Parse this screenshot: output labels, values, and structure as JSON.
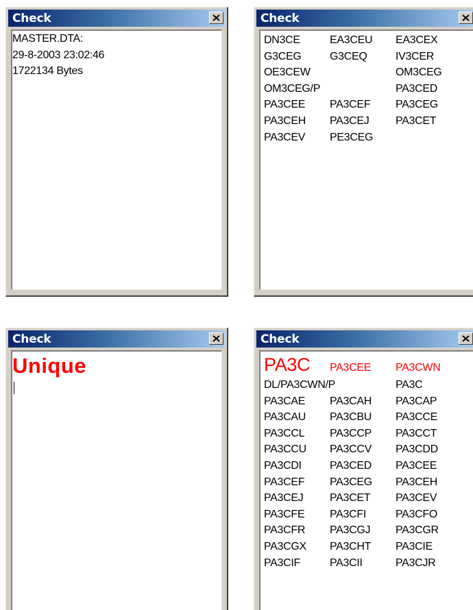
{
  "windows": {
    "w1": {
      "title": "Check",
      "lines": [
        "MASTER.DTA:",
        "29-8-2003 23:02:46",
        "1722134 Bytes"
      ]
    },
    "w2": {
      "title": "Check",
      "calls": [
        "DN3CE",
        "EA3CEU",
        "EA3CEX",
        "G3CEG",
        "G3CEQ",
        "IV3CER",
        "OE3CEW",
        "OM3CEG",
        "OM3CEG/P",
        "PA3CED",
        "PA3CEE",
        "PA3CEF",
        "PA3CEG",
        "PA3CEH",
        "PA3CEJ",
        "PA3CET",
        "PA3CEV",
        "PE3CEG"
      ]
    },
    "w3": {
      "title": "Check",
      "status": "Unique",
      "status_color": "#ff0000"
    },
    "w4": {
      "title": "Check",
      "query": "PA3C",
      "highlight_calls": [
        "PA3CEE",
        "PA3CWN"
      ],
      "highlight_color": "#ff0000",
      "calls": [
        "DL/PA3CWN/P",
        "PA3C",
        "PA3CAE",
        "PA3CAH",
        "PA3CAP",
        "PA3CAU",
        "PA3CBU",
        "PA3CCE",
        "PA3CCL",
        "PA3CCP",
        "PA3CCT",
        "PA3CCU",
        "PA3CCV",
        "PA3CDD",
        "PA3CDI",
        "PA3CED",
        "PA3CEE",
        "PA3CEF",
        "PA3CEG",
        "PA3CEH",
        "PA3CEJ",
        "PA3CET",
        "PA3CEV",
        "PA3CFE",
        "PA3CFI",
        "PA3CFO",
        "PA3CFR",
        "PA3CGJ",
        "PA3CGR",
        "PA3CGX",
        "PA3CHT",
        "PA3CIE",
        "PA3CIF",
        "PA3CII",
        "PA3CJR"
      ]
    }
  },
  "icons": {
    "close": "close-icon"
  }
}
